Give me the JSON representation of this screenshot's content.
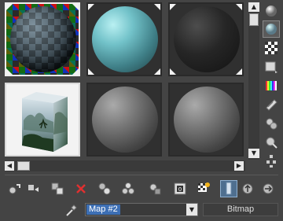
{
  "window": {
    "title": ""
  },
  "slots": [
    {
      "material": "checker"
    },
    {
      "material": "teal"
    },
    {
      "material": "black"
    },
    {
      "material": "bitmap-cube"
    },
    {
      "material": "grey"
    },
    {
      "material": "grey"
    }
  ],
  "map": {
    "name": "Map #2",
    "type_label": "Bitmap"
  },
  "colors": {
    "panel": "#444444",
    "selection": "#3d6fb4"
  },
  "icons": {
    "right_toolbar": [
      "sample-type-sphere-icon",
      "backlight-icon",
      "background-checker-icon",
      "sample-uv-tiling-icon",
      "video-color-check-icon",
      "make-preview-icon",
      "options-icon",
      "select-by-material-icon",
      "material-map-navigator-icon"
    ],
    "bottom_toolbar": [
      "get-material-icon",
      "put-to-scene-icon",
      "assign-to-selection-icon",
      "reset-map-icon",
      "delete-icon",
      "copy-material-icon",
      "make-unique-icon",
      "put-to-library-icon",
      "material-id-channel-icon",
      "show-map-in-viewport-icon",
      "show-end-result-icon",
      "go-to-parent-icon",
      "go-forward-to-sibling-icon"
    ]
  }
}
